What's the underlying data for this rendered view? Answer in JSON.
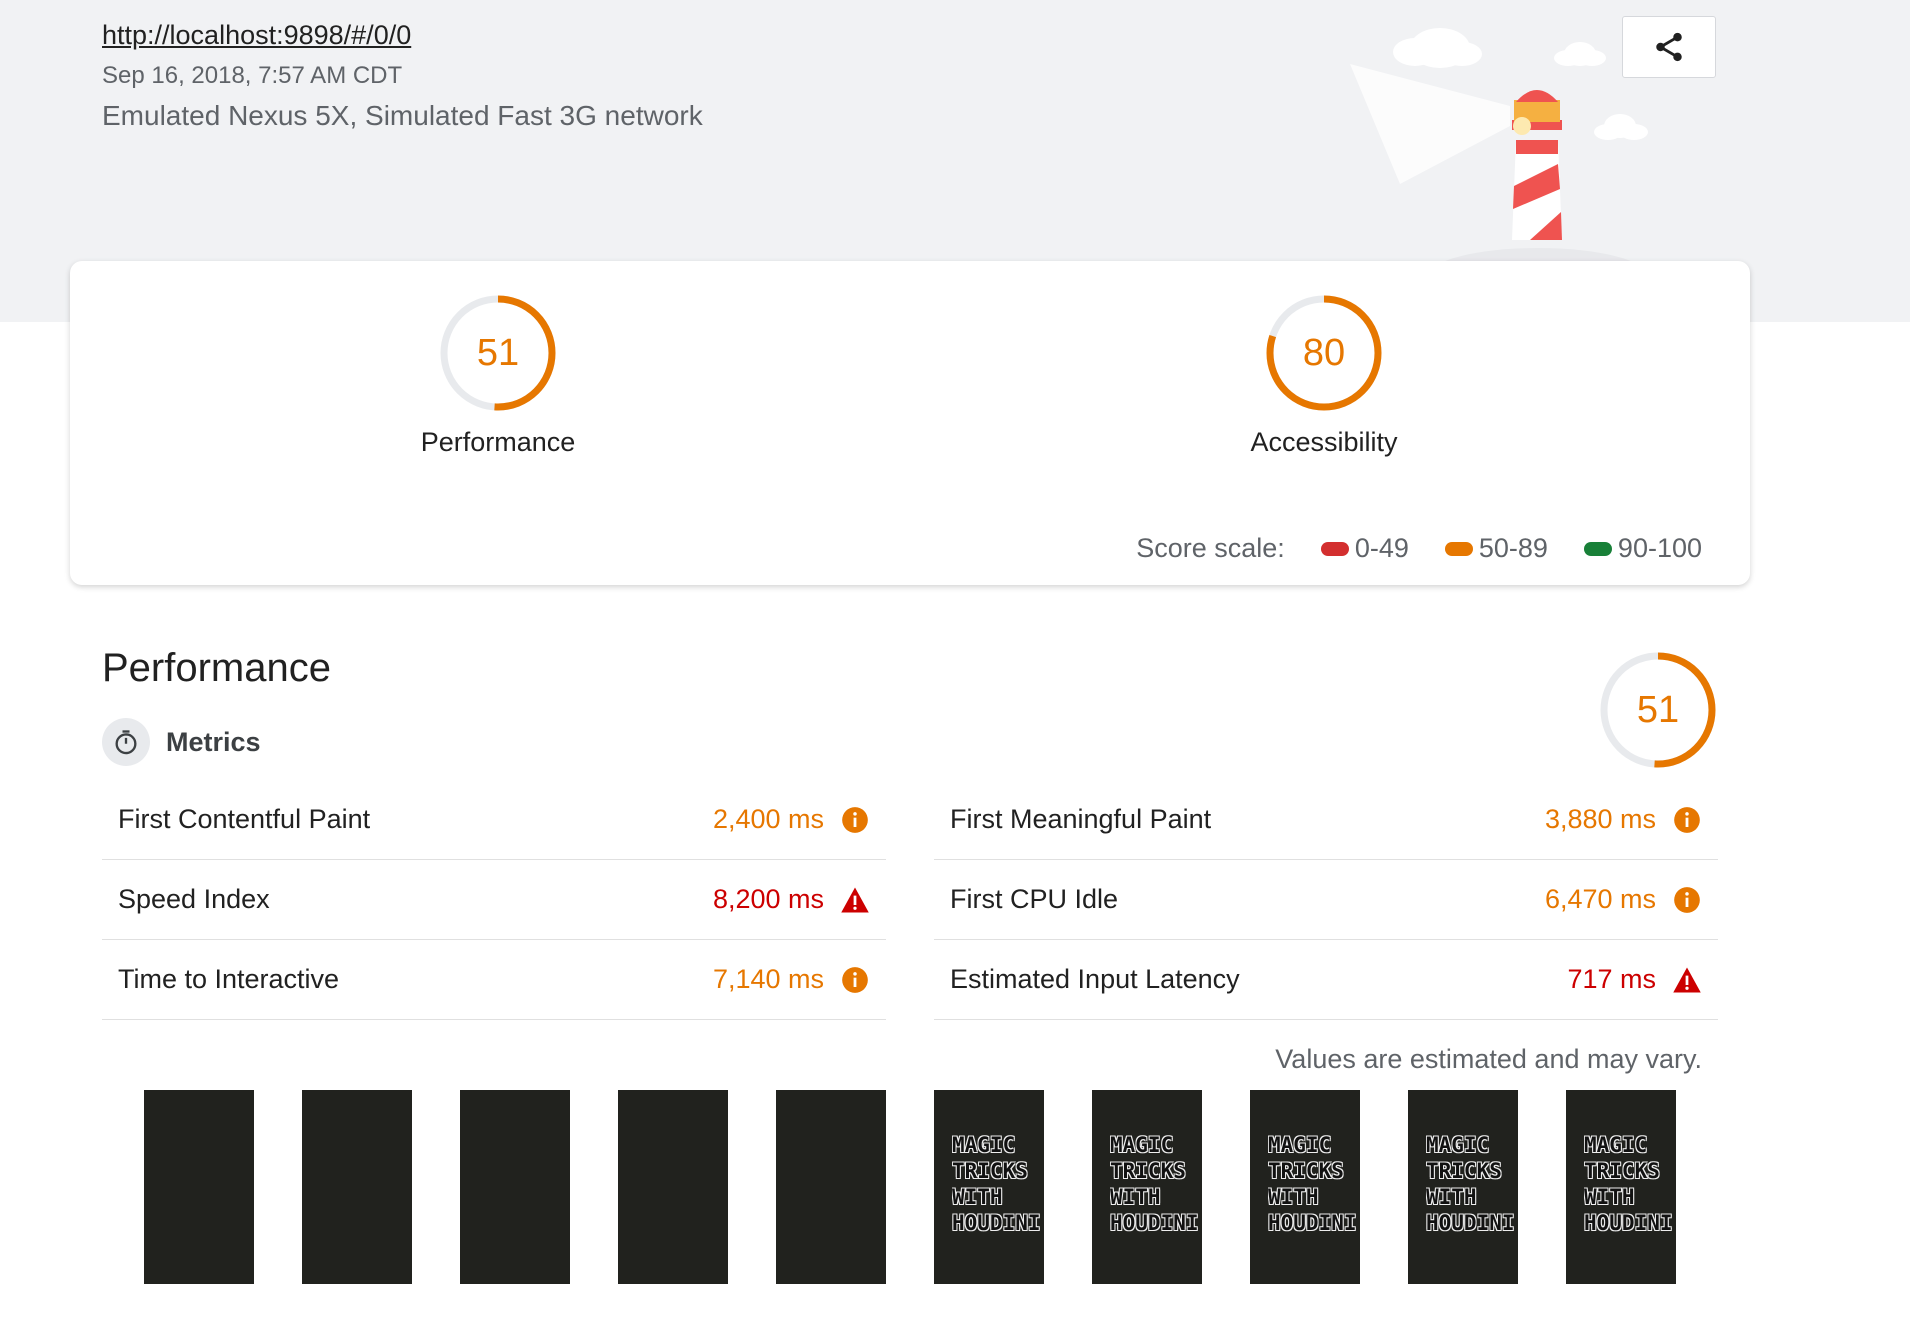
{
  "header": {
    "url": "http://localhost:9898/#/0/0",
    "date": "Sep 16, 2018, 7:57 AM CDT",
    "environment": "Emulated Nexus 5X, Simulated Fast 3G network"
  },
  "summary": {
    "gauges": [
      {
        "score": "51",
        "label": "Performance",
        "fraction": 0.51
      },
      {
        "score": "80",
        "label": "Accessibility",
        "fraction": 0.8
      }
    ],
    "scale_label": "Score scale:",
    "scale_ranges": [
      {
        "label": "0-49",
        "color": "#d32f2f"
      },
      {
        "label": "50-89",
        "color": "#e67700"
      },
      {
        "label": "90-100",
        "color": "#188038"
      }
    ]
  },
  "performance": {
    "title": "Performance",
    "score": "51",
    "score_fraction": 0.51,
    "metrics_label": "Metrics",
    "metrics_left": [
      {
        "name": "First Contentful Paint",
        "value": "2,400 ms",
        "status": "average"
      },
      {
        "name": "Speed Index",
        "value": "8,200 ms",
        "status": "fail"
      },
      {
        "name": "Time to Interactive",
        "value": "7,140 ms",
        "status": "average"
      }
    ],
    "metrics_right": [
      {
        "name": "First Meaningful Paint",
        "value": "3,880 ms",
        "status": "average"
      },
      {
        "name": "First CPU Idle",
        "value": "6,470 ms",
        "status": "average"
      },
      {
        "name": "Estimated Input Latency",
        "value": "717 ms",
        "status": "fail"
      }
    ],
    "disclaimer": "Values are estimated and may vary.",
    "filmstrip_text": [
      "MAGIC",
      "TRICKS",
      "WITH",
      "HOUDINI"
    ],
    "filmstrip": [
      false,
      false,
      false,
      false,
      false,
      true,
      true,
      true,
      true,
      true
    ]
  },
  "colors": {
    "average": "#e67700",
    "fail": "#cc0000",
    "gauge_track": "#e8eaed"
  }
}
